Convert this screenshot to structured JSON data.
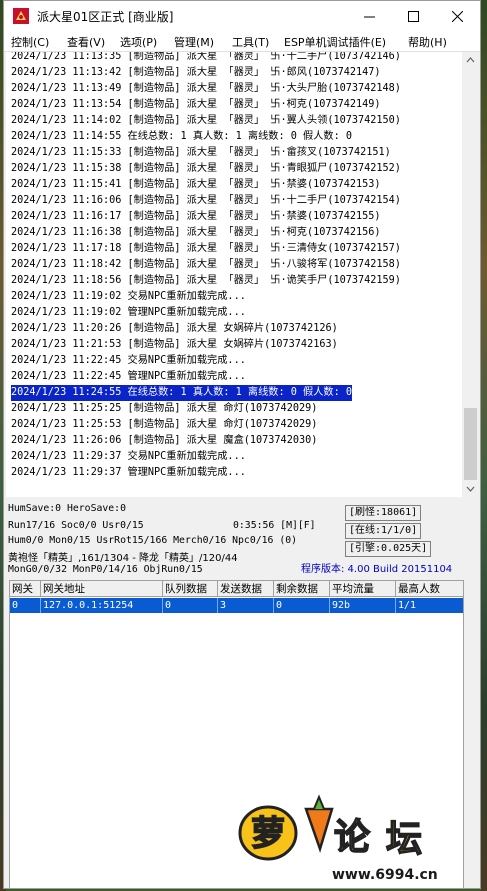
{
  "window": {
    "title": "派大星01区正式 [商业版]",
    "controls": [
      "minimize-icon",
      "maximize-icon",
      "close-icon"
    ]
  },
  "menu": [
    "控制(C)",
    "查看(V)",
    "选项(P)",
    "管理(M)",
    "工具(T)",
    "ESP单机调试插件(E)",
    "帮助(H)"
  ],
  "log": [
    {
      "text": "2024/1/23 11:13:35 [制造物品] 派大星 「器灵」 卐·十二手尸(1073742146)",
      "selected": false
    },
    {
      "text": "2024/1/23 11:13:42 [制造物品] 派大星 「器灵」 卐·郎风(1073742147)",
      "selected": false
    },
    {
      "text": "2024/1/23 11:13:49 [制造物品] 派大星 「器灵」 卐·大头尸胎(1073742148)",
      "selected": false
    },
    {
      "text": "2024/1/23 11:13:54 [制造物品] 派大星 「器灵」 卐·柯克(1073742149)",
      "selected": false
    },
    {
      "text": "2024/1/23 11:14:02 [制造物品] 派大星 「器灵」 卐·翼人头领(1073742150)",
      "selected": false
    },
    {
      "text": "2024/1/23 11:14:55 在线总数: 1 真人数: 1 离线数: 0 假人数: 0",
      "selected": false
    },
    {
      "text": "2024/1/23 11:15:33 [制造物品] 派大星 「器灵」 卐·畲孩叉(1073742151)",
      "selected": false
    },
    {
      "text": "2024/1/23 11:15:38 [制造物品] 派大星 「器灵」 卐·青眼狐尸(1073742152)",
      "selected": false
    },
    {
      "text": "2024/1/23 11:15:41 [制造物品] 派大星 「器灵」 卐·禁婆(1073742153)",
      "selected": false
    },
    {
      "text": "2024/1/23 11:16:06 [制造物品] 派大星 「器灵」 卐·十二手尸(1073742154)",
      "selected": false
    },
    {
      "text": "2024/1/23 11:16:17 [制造物品] 派大星 「器灵」 卐·禁婆(1073742155)",
      "selected": false
    },
    {
      "text": "2024/1/23 11:16:38 [制造物品] 派大星 「器灵」 卐·柯克(1073742156)",
      "selected": false
    },
    {
      "text": "2024/1/23 11:17:18 [制造物品] 派大星 「器灵」 卐·三清侍女(1073742157)",
      "selected": false
    },
    {
      "text": "2024/1/23 11:18:42 [制造物品] 派大星 「器灵」 卐·八骏将军(1073742158)",
      "selected": false
    },
    {
      "text": "2024/1/23 11:18:56 [制造物品] 派大星 「器灵」 卐·诡笑手尸(1073742159)",
      "selected": false
    },
    {
      "text": "2024/1/23 11:19:02 交易NPC重新加载完成...",
      "selected": false
    },
    {
      "text": "2024/1/23 11:19:02 管理NPC重新加载完成...",
      "selected": false
    },
    {
      "text": "2024/1/23 11:20:26 [制造物品] 派大星 女娲碎片(1073742126)",
      "selected": false
    },
    {
      "text": "2024/1/23 11:21:53 [制造物品] 派大星 女娲碎片(1073742163)",
      "selected": false
    },
    {
      "text": "2024/1/23 11:22:45 交易NPC重新加载完成...",
      "selected": false
    },
    {
      "text": "2024/1/23 11:22:45 管理NPC重新加载完成...",
      "selected": false
    },
    {
      "text": "2024/1/23 11:24:55 在线总数: 1 真人数: 1 离线数: 0 假人数: 0",
      "selected": true
    },
    {
      "text": "2024/1/23 11:25:25 [制造物品] 派大星 命灯(1073742029)",
      "selected": false
    },
    {
      "text": "2024/1/23 11:25:53 [制造物品] 派大星 命灯(1073742029)",
      "selected": false
    },
    {
      "text": "2024/1/23 11:26:06 [制造物品] 派大星 魔盒(1073742030)",
      "selected": false
    },
    {
      "text": "2024/1/23 11:29:37 交易NPC重新加载完成...",
      "selected": false
    },
    {
      "text": "2024/1/23 11:29:37 管理NPC重新加载完成...",
      "selected": false
    }
  ],
  "status": {
    "humsave": "HumSave:0 HeroSave:0",
    "run": "Run17/16 Soc0/0 Usr0/15",
    "timer": "0:35:56 [M][F]",
    "hum": "Hum0/0 Mon0/15 UsrRot15/166 Merch0/16 Npc0/16 (0)",
    "boss": "黄袍怪「精英」,161/1304 - 降龙「精英」/120/44",
    "mon": "MonG0/0/32 MonP0/14/16 ObjRun0/15",
    "refresh_mon": "[刷怪:18061]",
    "online": "[在线:1/1/0]",
    "engine": "[引擎:0.025天]",
    "version": "程序版本: 4.00 Build 20151104"
  },
  "table": {
    "headers": [
      "网关",
      "网关地址",
      "队列数据",
      "发送数据",
      "剩余数据",
      "平均流量",
      "最高人数"
    ],
    "rows": [
      [
        "0",
        "127.0.0.1:51254",
        "0",
        "3",
        "0",
        "92b",
        "1/1"
      ]
    ]
  },
  "watermark": {
    "brand": "萝卜论坛",
    "url": "www.6994.cn"
  },
  "colors": {
    "selection": "#0a24c8",
    "row_selection": "#0a5ad2",
    "version_text": "#0000c0"
  }
}
